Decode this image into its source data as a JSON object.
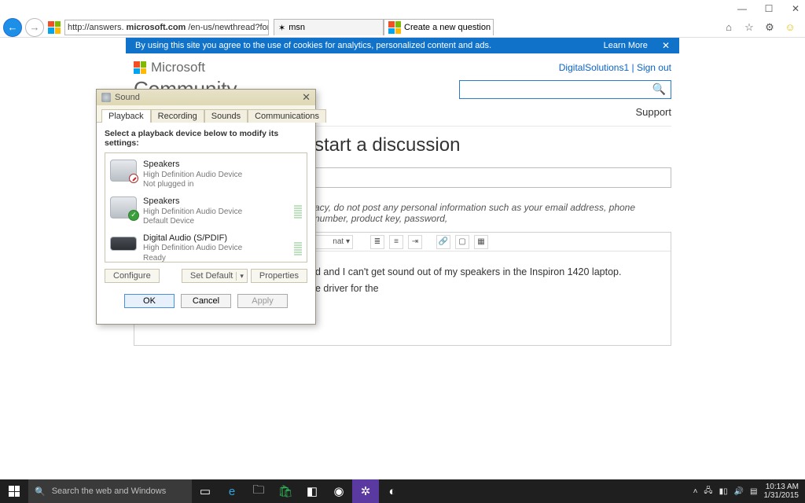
{
  "window": {
    "min": "—",
    "max": "☐",
    "close": "✕"
  },
  "browser": {
    "url_prefix": "http://answers.",
    "url_host": "microsoft.com",
    "url_path": "/en-us/newthread?forum=in",
    "search_glyph": "🔍",
    "refresh_glyph": "⟳",
    "tabs": [
      {
        "label": "msn",
        "active": false
      },
      {
        "label": "Create a new question or st...",
        "active": true
      }
    ],
    "fav_home": "⌂",
    "fav_star": "☆",
    "fav_gear": "⚙",
    "fav_smile": "☺"
  },
  "cookie": {
    "msg": "By using this site you agree to the use of cookies for analytics, personalized content and ads.",
    "learn": "Learn More",
    "close": "✕"
  },
  "header": {
    "brand": "Microsoft",
    "community": "Community",
    "user": "DigitalSolutions1",
    "sep": " | ",
    "signout": "Sign out",
    "support": "Support",
    "search_glyph": "🔍"
  },
  "page": {
    "title": "start a discussion",
    "disclaimer": "acy, do not post any personal information such as your email address, phone number, product key, password,",
    "editor_line1": "d and I can't get sound out of my speakers in the Inspiron 1420 laptop.",
    "editor_line2": "e driver for the",
    "fmt_label": "nat",
    "fmt_caret": "▾"
  },
  "toolbar_icons": {
    "ul": "≣",
    "ol": "≡",
    "indent": "⇥",
    "link": "🔗",
    "image": "▢",
    "table": "▦"
  },
  "dialog": {
    "title": "Sound",
    "close": "✕",
    "tabs": [
      "Playback",
      "Recording",
      "Sounds",
      "Communications"
    ],
    "active_tab": 0,
    "instruction": "Select a playback device below to modify its settings:",
    "devices": [
      {
        "name": "Speakers",
        "sub1": "High Definition Audio Device",
        "sub2": "Not plugged in",
        "state": "disabled",
        "meter": false
      },
      {
        "name": "Speakers",
        "sub1": "High Definition Audio Device",
        "sub2": "Default Device",
        "state": "default",
        "meter": true
      },
      {
        "name": "Digital Audio (S/PDIF)",
        "sub1": "High Definition Audio Device",
        "sub2": "Ready",
        "state": "spdif",
        "meter": true
      }
    ],
    "configure": "Configure",
    "setdefault": "Set Default",
    "properties": "Properties",
    "ok": "OK",
    "cancel": "Cancel",
    "apply": "Apply"
  },
  "taskbar": {
    "search_placeholder": "Search the web and Windows",
    "tray_up": "˄",
    "time": "10:13 AM",
    "date": "1/31/2015"
  }
}
